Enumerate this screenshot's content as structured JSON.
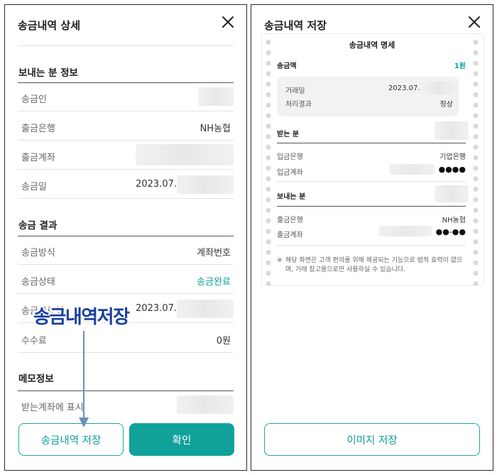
{
  "left": {
    "title": "송금내역 상세",
    "sender_section": {
      "title": "보내는 분 정보",
      "rows": [
        {
          "label": "송금인",
          "value": ""
        },
        {
          "label": "출금은행",
          "value": "NH농협"
        },
        {
          "label": "출금계좌",
          "value": ""
        },
        {
          "label": "송금일",
          "value": "2023.07."
        }
      ]
    },
    "result_section": {
      "title": "송금 결과",
      "rows": [
        {
          "label": "송금방식",
          "value": "계좌번호"
        },
        {
          "label": "송금상태",
          "value": "송금완료"
        },
        {
          "label": "송금완료일",
          "value": "2023.07."
        },
        {
          "label": "수수료",
          "value": "0원"
        }
      ]
    },
    "memo_section": {
      "title": "메모정보",
      "rows": [
        {
          "label": "받는계좌에 표시",
          "value": ""
        }
      ]
    },
    "buttons": {
      "save_history": "송금내역 저장",
      "confirm": "확인"
    },
    "annotation": "송금내역저장"
  },
  "right": {
    "title": "송금내역 저장",
    "receipt": {
      "title": "송금내역 명세",
      "amount_label": "송금액",
      "amount_value": "1원",
      "transaction_date_label": "거래일",
      "transaction_date_value": "2023.07.",
      "process_result_label": "처리결과",
      "process_result_value": "정상",
      "recipient_title": "받는 분",
      "deposit_bank_label": "입금은행",
      "deposit_bank_value": "기업은행",
      "deposit_account_label": "입금계좌",
      "deposit_account_value": "●●●●",
      "sender_title": "보내는 분",
      "withdraw_bank_label": "출금은행",
      "withdraw_bank_value": "NH농협",
      "withdraw_account_label": "출금계좌",
      "withdraw_account_value": "●●-●●",
      "note_mark": "※",
      "note_text": "해당 화면은 고객 편의를 위해 제공되는 기능으로 법적 효력이 없으며, 거래 참고용으로만 사용하실 수 있습니다."
    },
    "buttons": {
      "save_image": "이미지 저장"
    }
  },
  "colors": {
    "accent": "#11a19b",
    "accent_text": "#0e9e9a",
    "annotation": "#1a3f9e"
  },
  "icons": [
    "close-icon",
    "arrow-down-icon"
  ]
}
